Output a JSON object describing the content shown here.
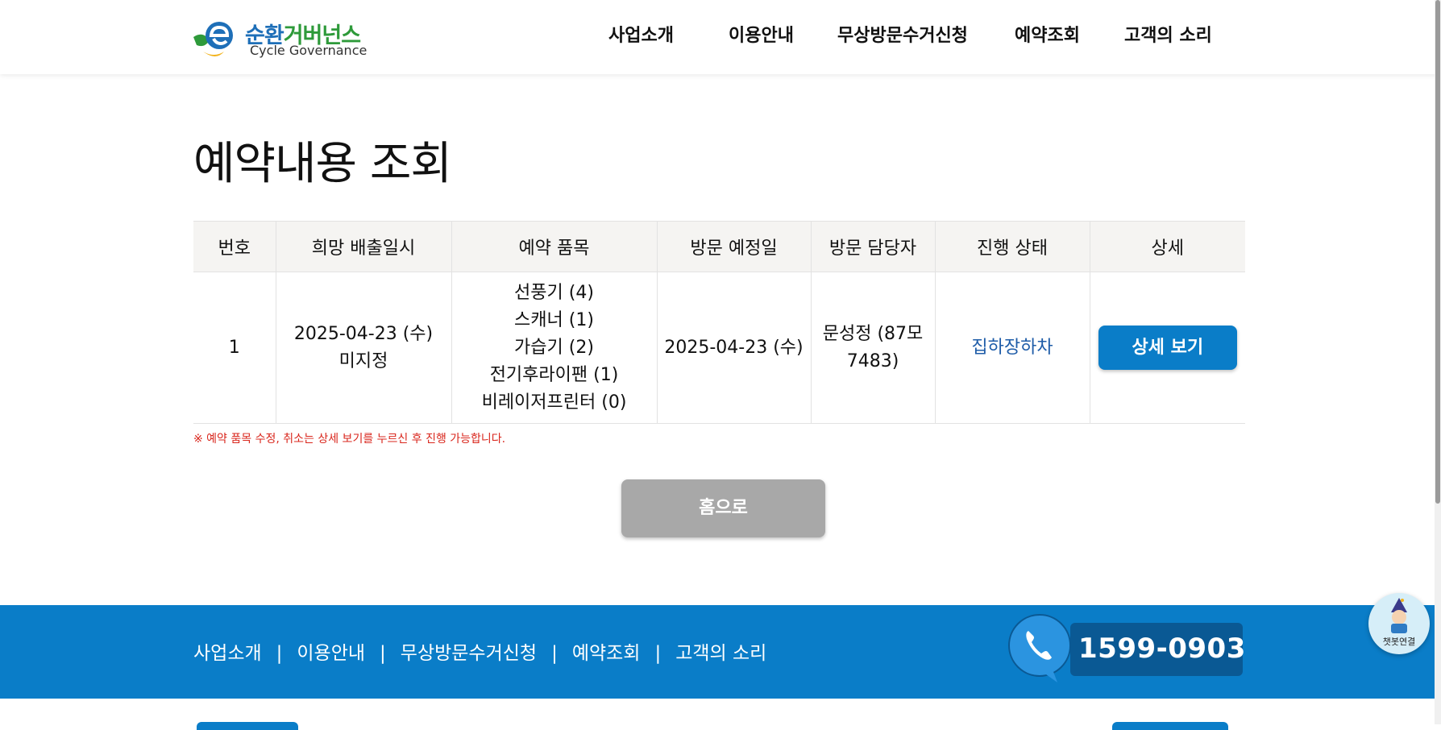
{
  "header": {
    "logo_name_a": "순환",
    "logo_name_b": "거버넌스",
    "logo_sub": "Cycle Governance",
    "nav": [
      "사업소개",
      "이용안내",
      "무상방문수거신청",
      "예약조회",
      "고객의 소리"
    ]
  },
  "page_title": "예약내용 조회",
  "table": {
    "headers": [
      "번호",
      "희망 배출일시",
      "예약 품목",
      "방문 예정일",
      "방문 담당자",
      "진행 상태",
      "상세"
    ],
    "row": {
      "no": "1",
      "desired_date": "2025-04-23 (수)",
      "desired_time": "미지정",
      "items": [
        "선풍기 (4)",
        "스캐너 (1)",
        "가습기 (2)",
        "전기후라이팬 (1)",
        "비레이저프린터 (0)"
      ],
      "visit_date": "2025-04-23 (수)",
      "staff": "문성정 (87모 7483)",
      "status": "집하장하차",
      "detail_label": "상세 보기"
    }
  },
  "notice": "※ 예약 품목 수정, 취소는 상세 보기를 누르신 후 진행 가능합니다.",
  "home_button": "홈으로",
  "footer": {
    "nav": [
      "사업소개",
      "이용안내",
      "무상방문수거신청",
      "예약조회",
      "고객의 소리"
    ],
    "separator": "|",
    "phone": "1599-0903"
  },
  "chatbot_label": "챗봇연결",
  "colors": {
    "accent": "#0a7dc8",
    "status_link": "#1e5ca8",
    "notice": "#d9261c",
    "home_button": "#a8a8a8"
  }
}
